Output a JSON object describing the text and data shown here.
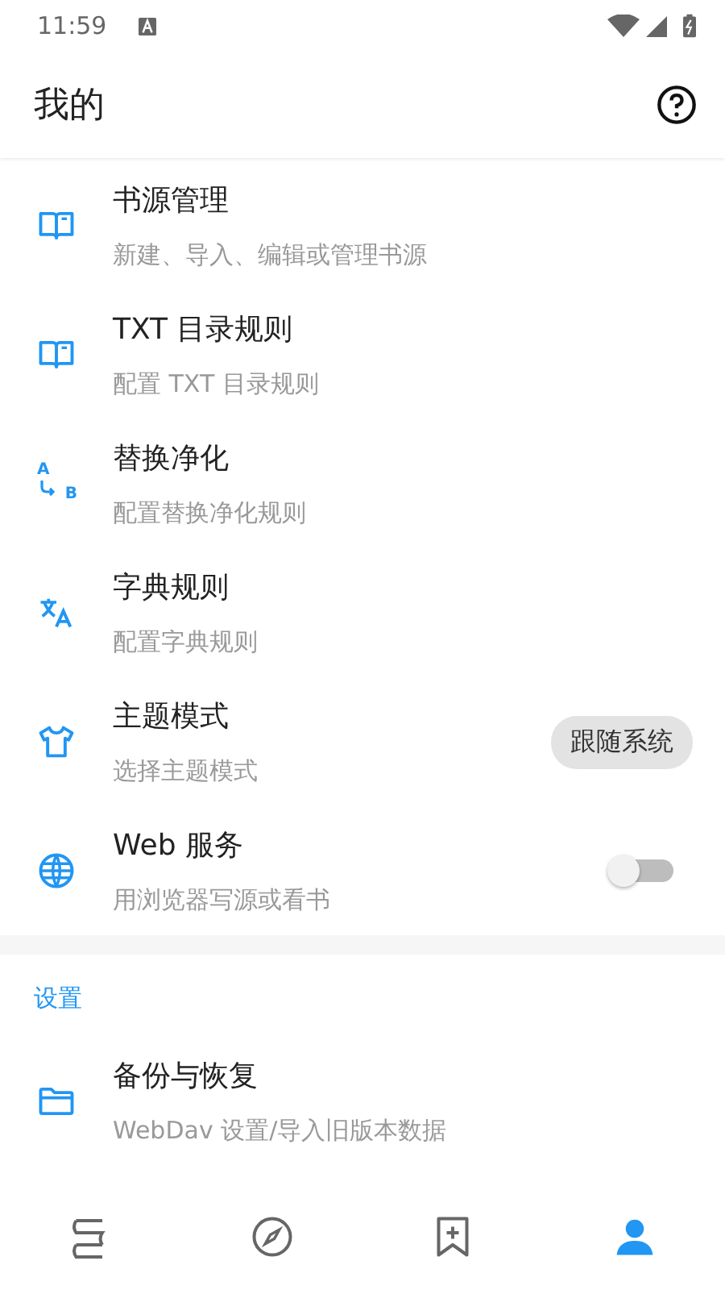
{
  "status_bar": {
    "time": "11:59"
  },
  "app_bar": {
    "title": "我的"
  },
  "items": [
    {
      "kind": "plain",
      "title": "书源管理",
      "subtitle": "新建、导入、编辑或管理书源"
    },
    {
      "kind": "plain",
      "title": "TXT 目录规则",
      "subtitle": "配置 TXT 目录规则"
    },
    {
      "kind": "plain",
      "title": "替换净化",
      "subtitle": "配置替换净化规则",
      "icon_letters": [
        "A",
        "B"
      ]
    },
    {
      "kind": "plain",
      "title": "字典规则",
      "subtitle": "配置字典规则"
    },
    {
      "kind": "chip",
      "title": "主题模式",
      "subtitle": "选择主题模式",
      "value": "跟随系统"
    },
    {
      "kind": "switch",
      "title": "Web 服务",
      "subtitle": "用浏览器写源或看书",
      "on": false
    }
  ],
  "settings": {
    "header": "设置",
    "items": [
      {
        "kind": "plain",
        "title": "备份与恢复",
        "subtitle": "WebDav 设置/导入旧版本数据"
      }
    ]
  },
  "bottom_nav": [
    {
      "selected": false
    },
    {
      "selected": false
    },
    {
      "selected": false
    },
    {
      "selected": true
    }
  ]
}
